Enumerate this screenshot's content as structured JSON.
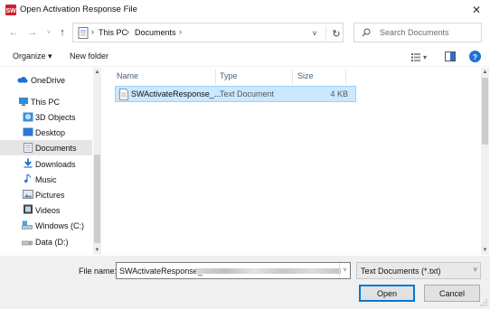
{
  "window": {
    "title": "Open Activation Response File",
    "close_glyph": "✕",
    "icon": "solidworks-app-icon"
  },
  "address": {
    "crumbs": [
      "This PC",
      "Documents"
    ],
    "search_placeholder": "Search Documents"
  },
  "toolbar": {
    "organize_label": "Organize ▾",
    "new_folder_label": "New folder",
    "help_label": "?"
  },
  "nav_items": [
    {
      "label": "OneDrive",
      "icon": "onedrive-icon"
    },
    {
      "label": "This PC",
      "icon": "this-pc-icon"
    },
    {
      "label": "3D Objects",
      "icon": "3d-objects-icon"
    },
    {
      "label": "Desktop",
      "icon": "desktop-icon"
    },
    {
      "label": "Documents",
      "icon": "documents-icon",
      "selected": true
    },
    {
      "label": "Downloads",
      "icon": "downloads-icon"
    },
    {
      "label": "Music",
      "icon": "music-icon"
    },
    {
      "label": "Pictures",
      "icon": "pictures-icon"
    },
    {
      "label": "Videos",
      "icon": "videos-icon"
    },
    {
      "label": "Windows (C:)",
      "icon": "drive-c-icon"
    },
    {
      "label": "Data (D:)",
      "icon": "drive-d-icon"
    }
  ],
  "columns": {
    "name": "Name",
    "type": "Type",
    "size": "Size"
  },
  "files": [
    {
      "name": "SWActivateResponse_...",
      "type": "Text Document",
      "size": "4 KB"
    }
  ],
  "footer": {
    "file_name_label": "File name:",
    "file_name_value": "SWActivateResponse_",
    "file_type_value": "Text Documents (*.txt)",
    "open_label": "Open",
    "cancel_label": "Cancel"
  },
  "colors": {
    "selection_bg": "#cce8ff",
    "selection_border": "#99d1ff",
    "accent": "#0078d7",
    "help": "#1e6fd9"
  }
}
